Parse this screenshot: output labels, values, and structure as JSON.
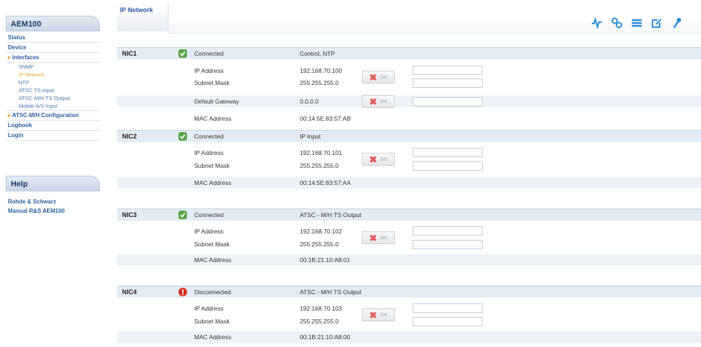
{
  "sidebar": {
    "header": "AEM100",
    "items": [
      {
        "label": "Status"
      },
      {
        "label": "Device"
      },
      {
        "label": "Interfaces"
      },
      {
        "label": "SNMP"
      },
      {
        "label": "IP Network"
      },
      {
        "label": "NTP"
      },
      {
        "label": "ATSC TS Input"
      },
      {
        "label": "ATSC-M/H TS Output"
      },
      {
        "label": "Mobile A/V Input"
      },
      {
        "label": "ATSC-M/H Configuration"
      },
      {
        "label": "Logbook"
      },
      {
        "label": "Login"
      }
    ],
    "help_header": "Help",
    "help_items": [
      {
        "label": "Rohde & Schwarz"
      },
      {
        "label": "Manual R&S AEM100"
      }
    ]
  },
  "tab": {
    "label": "IP Network"
  },
  "toolbar": {
    "icons": [
      "signal-icon",
      "settings-icon",
      "transfer-icon",
      "edit-icon",
      "key-icon"
    ],
    "accent": "#2c8fd6"
  },
  "set_button": {
    "label": "Set"
  },
  "nics": [
    {
      "name": "NIC1",
      "status": "Connected",
      "role": "Control, NTP",
      "ip_label": "IP Address",
      "ip": "192.168.70.100",
      "mask_label": "Subnet Mask",
      "mask": "255.255.255.0",
      "gw_label": "Default Gateway",
      "gw": "0.0.0.0",
      "mac_label": "MAC Address",
      "mac": "00:14:5E:83:57:AB"
    },
    {
      "name": "NIC2",
      "status": "Connected",
      "role": "IP Input",
      "ip_label": "IP Address",
      "ip": "192.168.70.101",
      "mask_label": "Subnet Mask",
      "mask": "255.255.255.0",
      "mac_label": "MAC Address",
      "mac": "00:14:5E:83:57:AA"
    },
    {
      "name": "NIC3",
      "status": "Connected",
      "role": "ATSC - M/H TS Output",
      "ip_label": "IP Address",
      "ip": "192.168.70.102",
      "mask_label": "Subnet Mask",
      "mask": "255.255.255.0",
      "mac_label": "MAC Address",
      "mac": "00:1B:21:10:A8:01"
    },
    {
      "name": "NIC4",
      "status": "Disconnected",
      "role": "ATSC - M/H TS Output",
      "ip_label": "IP Address",
      "ip": "192.168.70.103",
      "mask_label": "Subnet Mask",
      "mask": "255.255.255.0",
      "mac_label": "MAC Address",
      "mac": "00:1B:21:10:A8:00"
    }
  ]
}
